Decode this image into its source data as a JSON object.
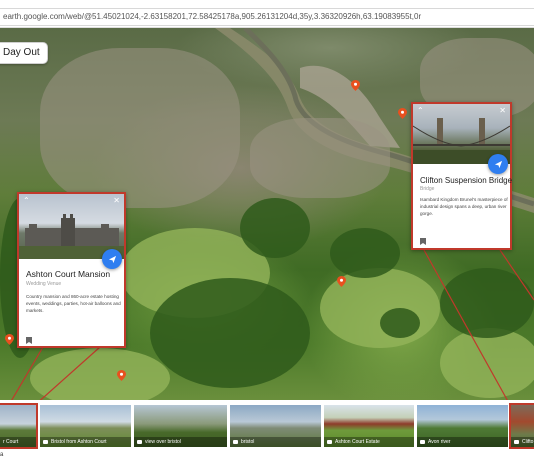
{
  "browser": {
    "url": "earth.google.com/web/@51.45021024,-2.63158201,72.58425178a,905.26131204d,35y,3.36320926h,63.19083955t,0r"
  },
  "tour": {
    "title": "Day Out"
  },
  "cards": {
    "ashton": {
      "title": "Ashton Court Mansion",
      "category": "Wedding Venue",
      "description": "Country mansion and 860-acre estate hosting events, weddings, parties, hot-air balloons and markets."
    },
    "clifton": {
      "title": "Clifton Suspension Bridge",
      "category": "Bridge",
      "description": "Isambard Kingdom Brunel's masterpiece of industrial design spans a deep, urban river gorge."
    }
  },
  "thumbnails": [
    {
      "caption": "r Court"
    },
    {
      "caption": "Bristol from Ashton Court"
    },
    {
      "caption": "view over bristol"
    },
    {
      "caption": "bristol"
    },
    {
      "caption": "Ashton Court Estate"
    },
    {
      "caption": "Avon river"
    },
    {
      "caption": "Clifto"
    }
  ],
  "strip_footer": "a",
  "colors": {
    "accent": "#c0392b",
    "share": "#2f7ef0",
    "pin": "#e8501f"
  },
  "icons": {
    "share": "paper-plane-icon",
    "bookmark": "bookmark-icon",
    "close": "close-icon",
    "collapse": "chevron-up-icon",
    "camera": "camera-icon",
    "pin": "map-pin-icon"
  }
}
